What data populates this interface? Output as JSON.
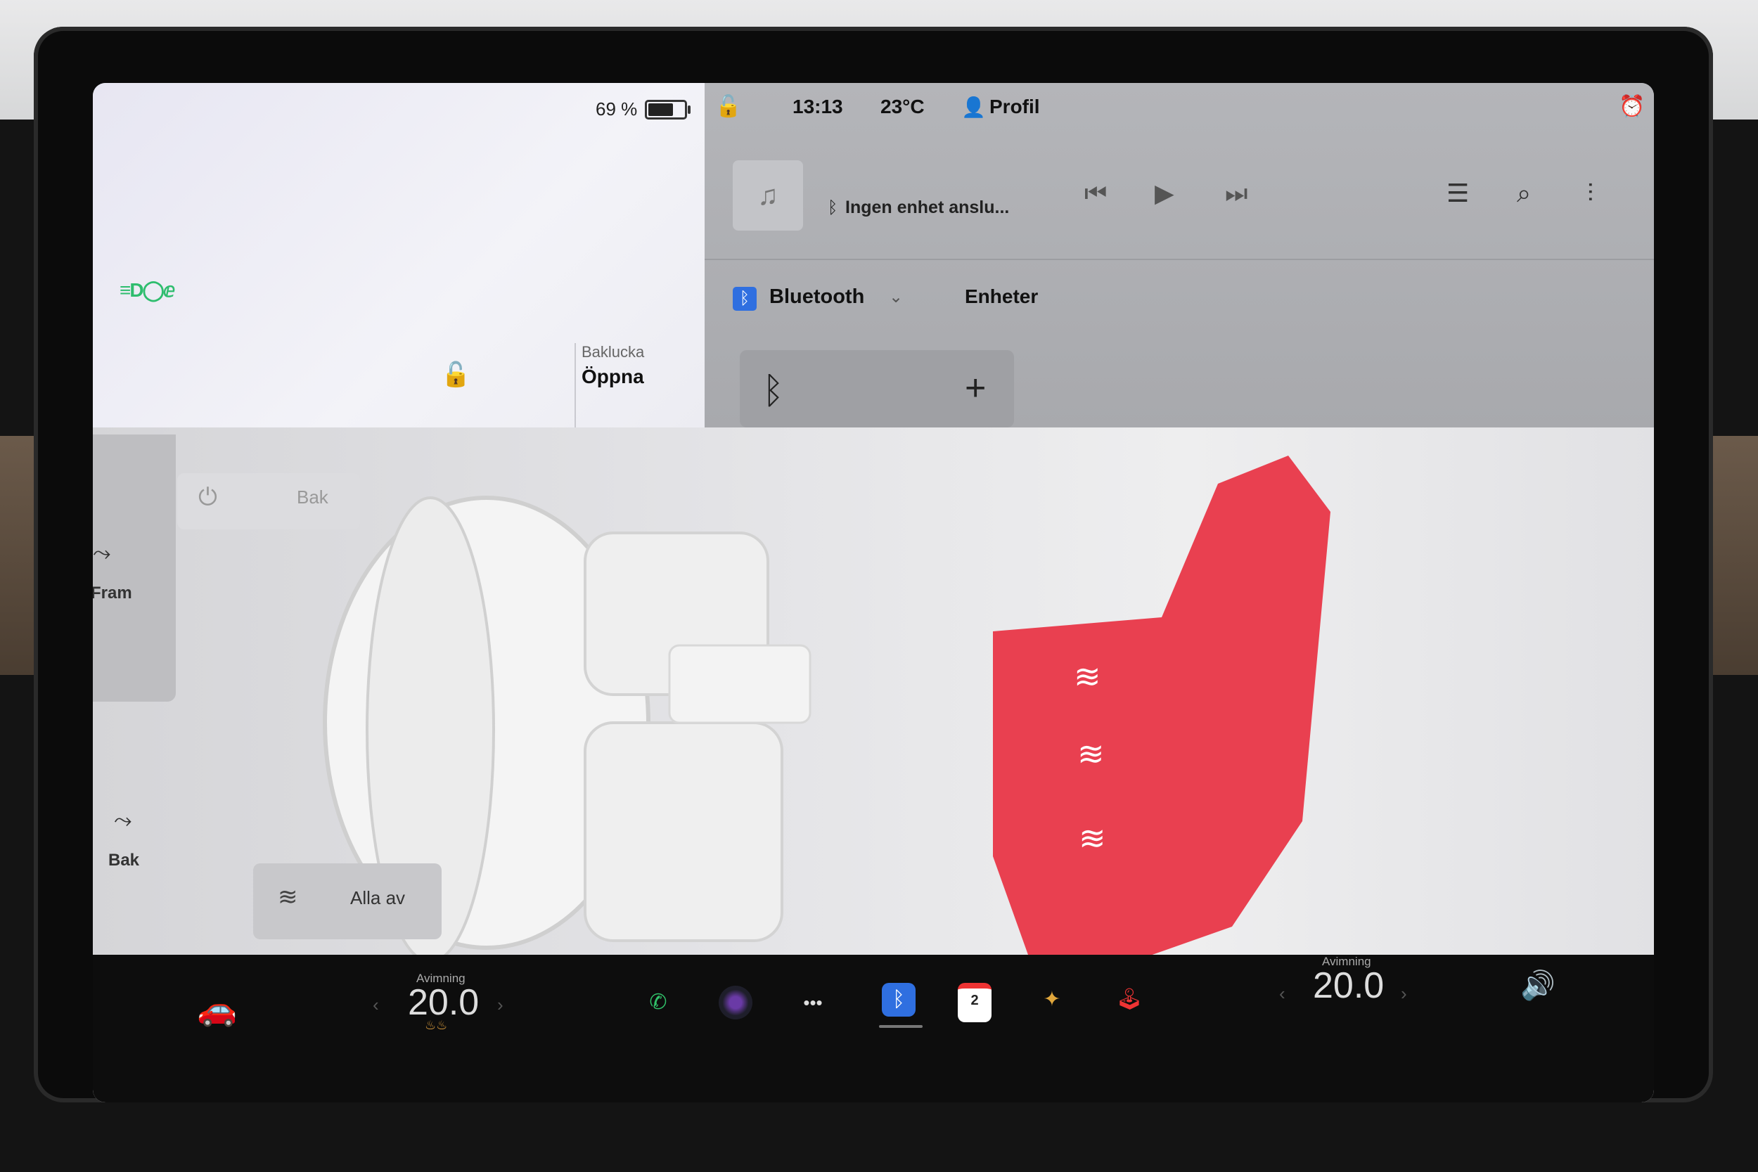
{
  "status": {
    "battery_percent": "69 %",
    "battery_level": 0.69,
    "time": "13:13",
    "temperature": "23°C",
    "profile_label": "Profil"
  },
  "vehicle": {
    "trunk_label": "Baklucka",
    "trunk_action": "Öppna"
  },
  "media": {
    "track_text": "Ingen enhet anslu...",
    "icons": [
      "music-note-icon",
      "prev-icon",
      "play-icon",
      "next-icon",
      "queue-icon",
      "search-icon",
      "equalizer-icon"
    ]
  },
  "bluetooth": {
    "title": "Bluetooth",
    "devices_title": "Enheter"
  },
  "climate": {
    "rear_power_label": "Bak",
    "front_label": "Fram",
    "rear_label": "Bak",
    "all_off_label": "Alla av"
  },
  "bottom_bar": {
    "left_defrost_label": "Avimning",
    "left_temp": "20.0",
    "right_defrost_label": "Avimning",
    "right_temp": "20.0",
    "calendar_day": "2"
  },
  "colors": {
    "accent_blue": "#2f6fe0",
    "seat_heat_red": "#e8283a",
    "phone_green": "#31c26a",
    "alarm_orange": "#e08a2a"
  }
}
